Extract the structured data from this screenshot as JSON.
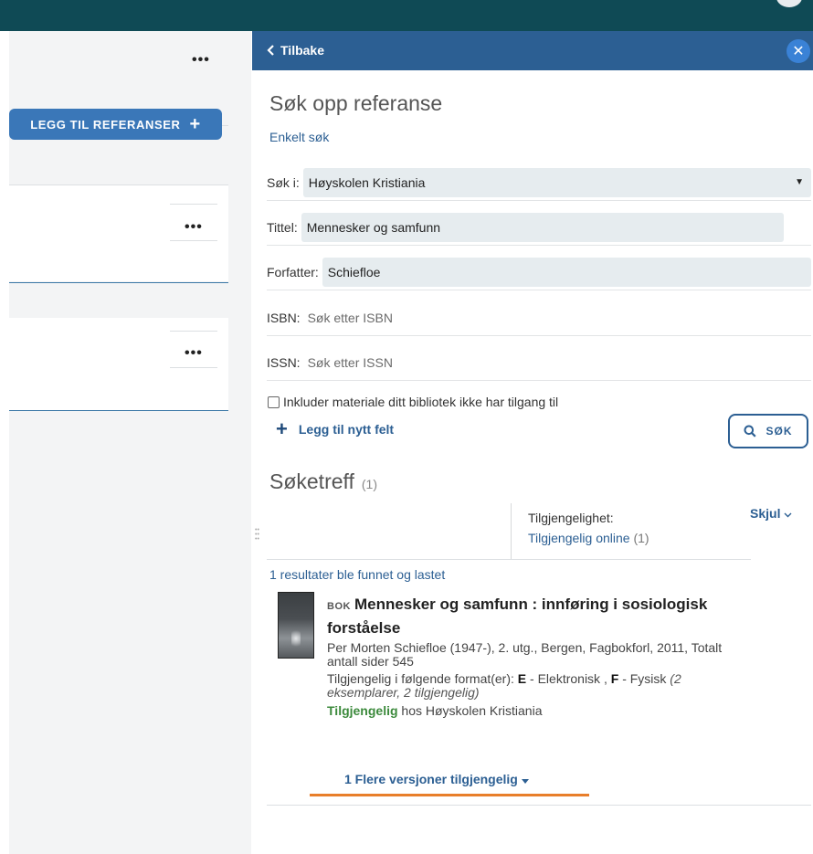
{
  "left": {
    "add_refs_label": "LEGG TIL REFERANSER",
    "plus_glyph": "+",
    "ellipsis": "•••"
  },
  "panel": {
    "back_label": "Tilbake",
    "close_glyph": "✕",
    "title": "Søk opp referanse",
    "subtitle": "Enkelt søk"
  },
  "form": {
    "search_in_label": "Søk i:",
    "search_in_value": "Høyskolen Kristiania",
    "title_label": "Tittel:",
    "title_value": "Mennesker og samfunn",
    "author_label": "Forfatter:",
    "author_value": "Schiefloe",
    "isbn_label": "ISBN:",
    "isbn_placeholder": "Søk etter ISBN",
    "issn_label": "ISSN:",
    "issn_placeholder": "Søk etter ISSN",
    "include_label": "Inkluder materiale ditt bibliotek ikke har tilgang til",
    "include_checked": false,
    "add_field_label": "Legg til nytt felt",
    "search_button_label": "SØK"
  },
  "results": {
    "title": "Søketreff",
    "count": "(1)",
    "facet_label": "Tilgjengelighet:",
    "facet_value": "Tilgjengelig online",
    "facet_count": "(1)",
    "hide_label": "Skjul",
    "found_text": "1 resultater ble funnet og lastet",
    "item": {
      "type": "BOK",
      "title": "Mennesker og samfunn : innføring i sosiologisk forståelse",
      "meta": "Per Morten Schiefloe (1947-), 2. utg., Bergen, Fagbokforl, 2011, Totalt antall sider 545",
      "formats_prefix": "Tilgjengelig i følgende format(er):",
      "format_e_code": "E",
      "format_e_label": "- Elektronisk ,",
      "format_f_code": "F",
      "format_f_label": "- Fysisk",
      "format_f_note": "(2 eksemplarer, 2 tilgjengelig)",
      "availability_status": "Tilgjengelig",
      "availability_rest": "hos Høyskolen Kristiania"
    },
    "versions_label": "1 Flere versjoner tilgjengelig"
  },
  "colors": {
    "topbar": "#0f4a55",
    "header": "#2c5f93",
    "accent": "#3a77b8",
    "link": "#2c5f93",
    "available": "#3c8a3c",
    "highlight": "#e87e2a"
  }
}
